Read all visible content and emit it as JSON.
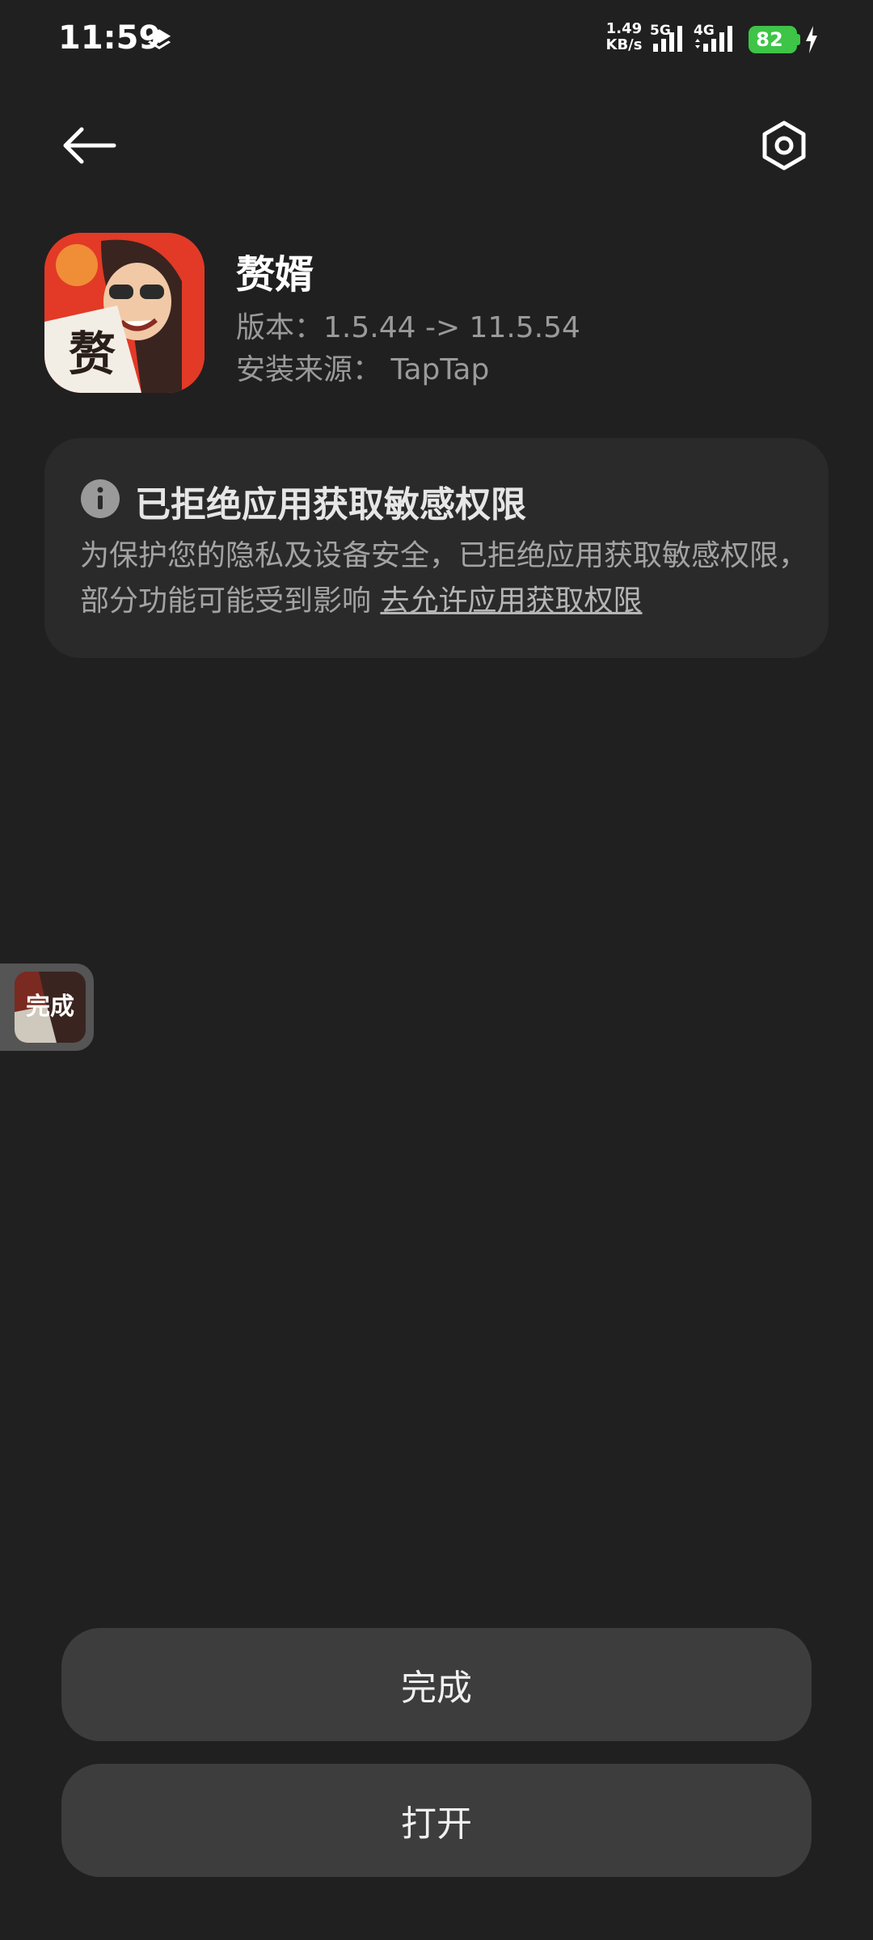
{
  "status_bar": {
    "time": "11:59",
    "net_speed_value": "1.49",
    "net_speed_unit": "KB/s",
    "signal_1_label": "5G",
    "signal_2_label": "4G",
    "battery_level": "82",
    "battery_color": "#3ec447",
    "icons": [
      "layers-icon",
      "signal-icon",
      "charging-icon"
    ]
  },
  "toolbar": {
    "back_icon": "arrow-left-icon",
    "settings_icon": "settings-icon"
  },
  "app": {
    "name": "赘婿",
    "version": "版本：1.5.44 -> 11.5.54",
    "source": "安装来源： TapTap"
  },
  "warning": {
    "icon": "info-icon",
    "title": "已拒绝应用获取敏感权限",
    "body": "为保护您的隐私及设备安全，已拒绝应用获取敏感权限，部分功能可能受到影响 ",
    "link": "去允许应用获取权限"
  },
  "floating_bubble": {
    "label": "完成"
  },
  "buttons": {
    "done": "完成",
    "open": "打开"
  }
}
